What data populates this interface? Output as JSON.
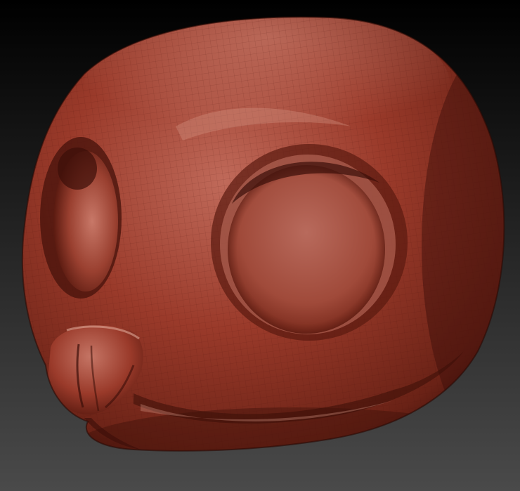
{
  "scene": {
    "subject_icon": "sculpted-head-icon",
    "colors": {
      "background_top": "#000000",
      "background_bottom": "#4a4a4a",
      "clay_base": "#9a3a2a",
      "clay_light": "#c06a5a",
      "clay_highlight": "#d89888",
      "clay_shadow": "#5a1a10",
      "clay_deep": "#3a0e08"
    }
  }
}
